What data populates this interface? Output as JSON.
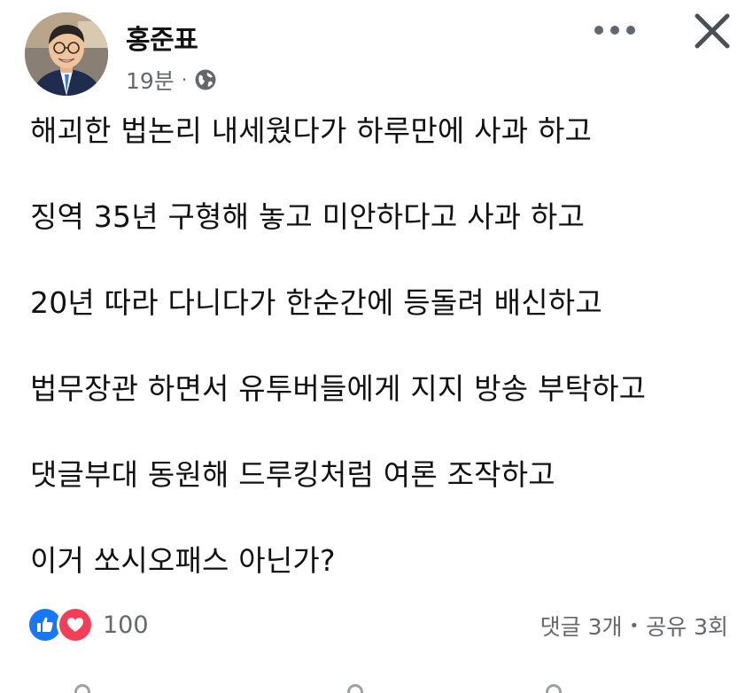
{
  "header": {
    "author_name": "홍준표",
    "time_ago": "19분",
    "dot": "·",
    "privacy_icon": "globe-icon",
    "more_icon": "more-dots-icon",
    "close_icon": "close-icon"
  },
  "body": {
    "lines": [
      "해괴한 법논리 내세웠다가 하루만에 사과 하고",
      "징역 35년 구형해 놓고 미안하다고 사과 하고",
      "20년 따라 다니다가 한순간에 등돌려 배신하고",
      "법무장관 하면서 유투버들에게 지지 방송 부탁하고",
      "댓글부대 동원해 드루킹처럼 여론 조작하고",
      "이거 쏘시오패스 아닌가?"
    ]
  },
  "footer": {
    "reaction_icons": [
      "like-icon",
      "love-icon"
    ],
    "reaction_count": "100",
    "comments": "댓글 3개",
    "separator": "•",
    "shares": "공유 3회"
  },
  "colors": {
    "like": "#1877f2",
    "love": "#f33e58",
    "meta": "#65676b",
    "text": "#111111"
  }
}
